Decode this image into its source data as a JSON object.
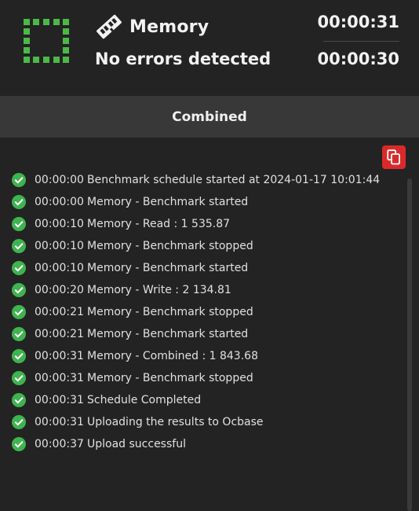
{
  "header": {
    "title": "Memory",
    "subtitle": "No errors detected",
    "elapsed_primary": "00:00:31",
    "elapsed_secondary": "00:00:30",
    "status_color": "#4cb848"
  },
  "tabs": {
    "active_label": "Combined"
  },
  "actions": {
    "copy_icon": "copy-icon",
    "copy_color": "#d92a2a"
  },
  "log": {
    "success_color": "#3fb34f",
    "entries": [
      {
        "time": "00:00:00",
        "message": "Benchmark schedule started at 2024-01-17 10:01:44"
      },
      {
        "time": "00:00:00",
        "message": "Memory - Benchmark started"
      },
      {
        "time": "00:00:10",
        "message": "Memory - Read : 1 535.87"
      },
      {
        "time": "00:00:10",
        "message": "Memory - Benchmark stopped"
      },
      {
        "time": "00:00:10",
        "message": "Memory - Benchmark started"
      },
      {
        "time": "00:00:20",
        "message": "Memory - Write : 2 134.81"
      },
      {
        "time": "00:00:21",
        "message": "Memory - Benchmark stopped"
      },
      {
        "time": "00:00:21",
        "message": "Memory - Benchmark started"
      },
      {
        "time": "00:00:31",
        "message": "Memory - Combined : 1 843.68"
      },
      {
        "time": "00:00:31",
        "message": "Memory - Benchmark stopped"
      },
      {
        "time": "00:00:31",
        "message": "Schedule Completed"
      },
      {
        "time": "00:00:31",
        "message": "Uploading the results to Ocbase"
      },
      {
        "time": "00:00:37",
        "message": "Upload successful"
      }
    ]
  }
}
